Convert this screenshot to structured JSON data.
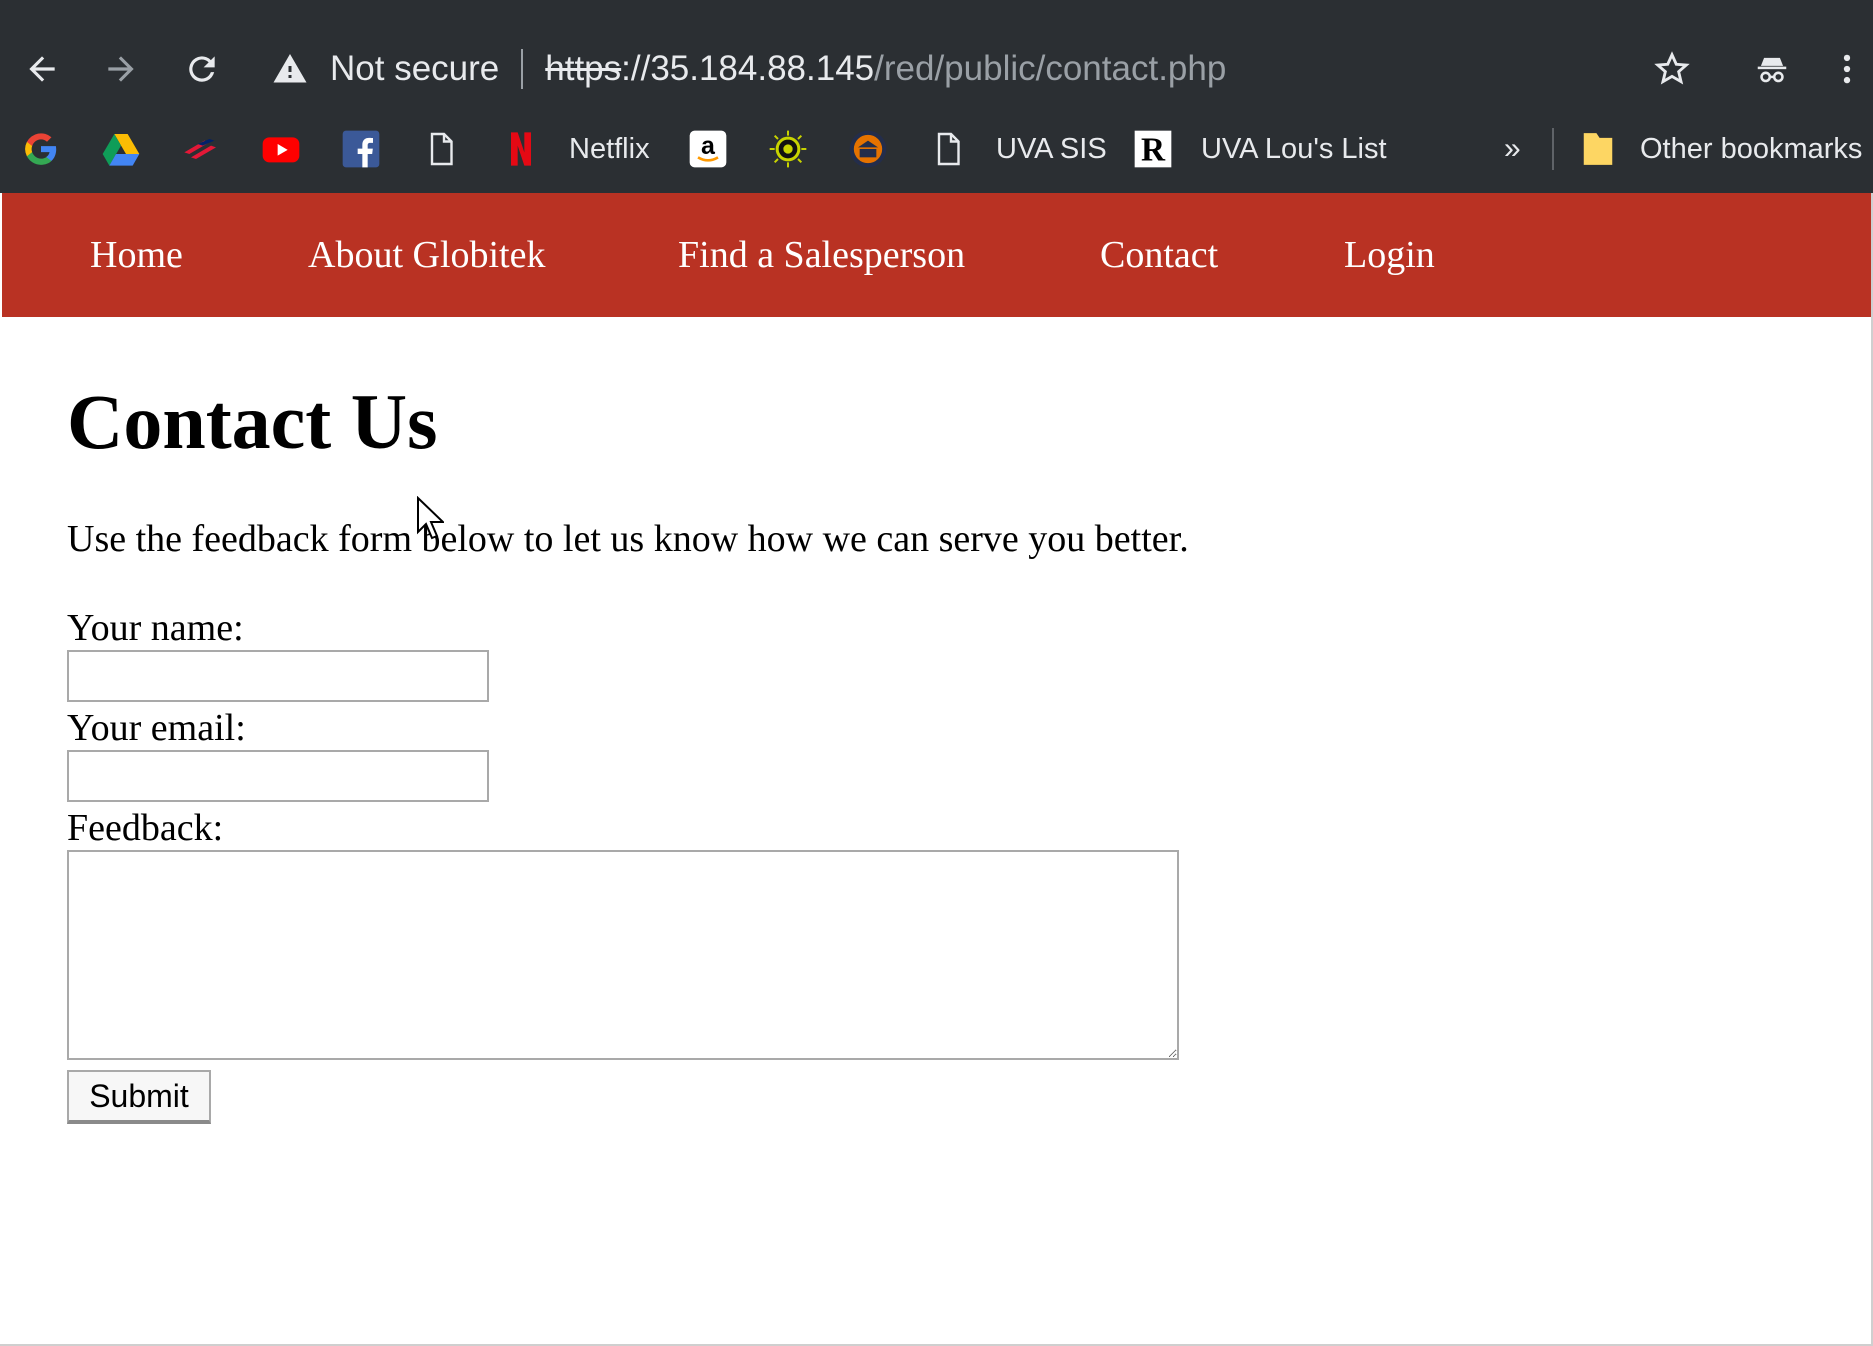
{
  "browser": {
    "security_label": "Not secure",
    "url_scheme": "https",
    "url_host": "://35.184.88.145",
    "url_path": "/red/public/contact.php",
    "bookmarks": [
      {
        "label": "",
        "icon": "google-icon"
      },
      {
        "label": "",
        "icon": "google-drive-icon"
      },
      {
        "label": "",
        "icon": "bank-of-america-icon"
      },
      {
        "label": "",
        "icon": "youtube-icon"
      },
      {
        "label": "",
        "icon": "facebook-icon"
      },
      {
        "label": "",
        "icon": "page-icon"
      },
      {
        "label": "Netflix",
        "icon": "netflix-icon"
      },
      {
        "label": "",
        "icon": "amazon-icon"
      },
      {
        "label": "",
        "icon": "sun-icon"
      },
      {
        "label": "",
        "icon": "uva-icon"
      },
      {
        "label": "UVA SIS",
        "icon": "page-icon"
      },
      {
        "label": "UVA Lou's List",
        "icon": "r-logo-icon"
      }
    ],
    "overflow_label": "»",
    "other_bookmarks": "Other bookmarks",
    "colors": {
      "chrome_bg": "#2b2f33",
      "nav_bg": "#b93223"
    }
  },
  "nav": {
    "items": [
      "Home",
      "About Globitek",
      "Find a Salesperson",
      "Contact",
      "Login"
    ]
  },
  "page": {
    "title": "Contact Us",
    "intro": "Use the feedback form below to let us know how we can serve you better.",
    "form": {
      "name_label": "Your name:",
      "name_value": "",
      "email_label": "Your email:",
      "email_value": "",
      "feedback_label": "Feedback:",
      "feedback_value": "",
      "submit_label": "Submit"
    }
  }
}
